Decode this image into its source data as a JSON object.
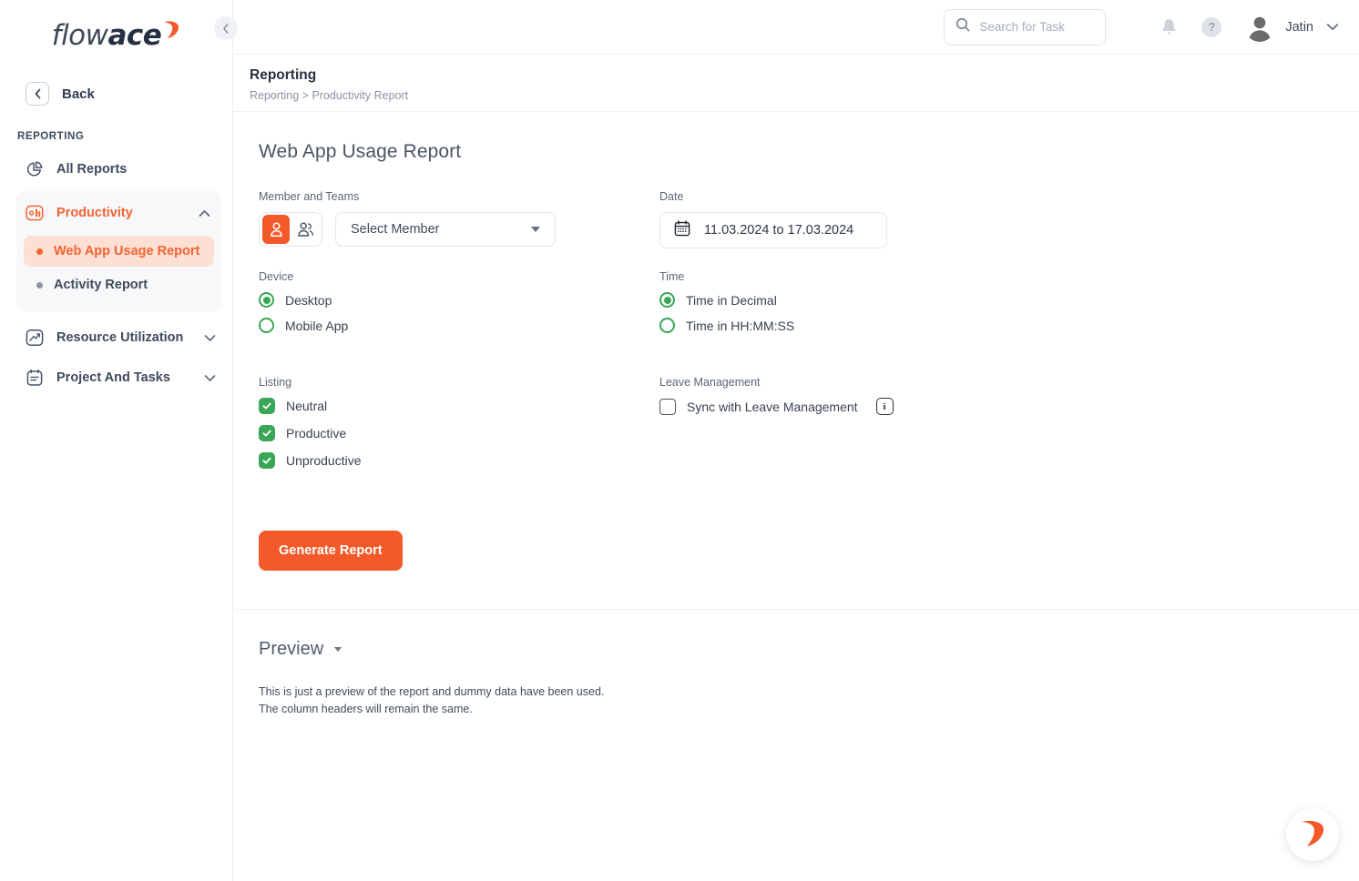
{
  "brand": {
    "logo_flow": "flow",
    "logo_ace": "ace",
    "accent_color": "#f4592a",
    "accent_light": "#fde0d3",
    "green": "#3aa757"
  },
  "sidebar": {
    "back_label": "Back",
    "section_label": "REPORTING",
    "items": [
      {
        "label": "All Reports",
        "icon": "pie-chart-icon"
      },
      {
        "label": "Productivity",
        "icon": "bar-chart-icon"
      },
      {
        "label": "Resource Utilization",
        "icon": "trend-up-icon"
      },
      {
        "label": "Project And Tasks",
        "icon": "calendar-list-icon"
      }
    ],
    "sub_items": [
      {
        "label": "Web App Usage Report"
      },
      {
        "label": "Activity Report"
      }
    ]
  },
  "topbar": {
    "search_placeholder": "Search for Task",
    "search_value": "",
    "help_label": "?",
    "user_name": "Jatin"
  },
  "page": {
    "title": "Reporting",
    "breadcrumb": "Reporting > Productivity Report",
    "report_title": "Web App Usage Report"
  },
  "form": {
    "member_label": "Member and Teams",
    "member_select_value": "Select Member",
    "date_label": "Date",
    "date_value": "11.03.2024 to 17.03.2024",
    "device_label": "Device",
    "device_options": [
      {
        "label": "Desktop",
        "selected": true
      },
      {
        "label": "Mobile App",
        "selected": false
      }
    ],
    "time_label": "Time",
    "time_options": [
      {
        "label": "Time in Decimal",
        "selected": true
      },
      {
        "label": "Time in HH:MM:SS",
        "selected": false
      }
    ],
    "listing_label": "Listing",
    "listing_options": [
      {
        "label": "Neutral",
        "checked": true
      },
      {
        "label": "Productive",
        "checked": true
      },
      {
        "label": "Unproductive",
        "checked": true
      }
    ],
    "leave_label": "Leave Management",
    "leave_sync_label": "Sync with Leave Management",
    "leave_sync_checked": false,
    "info_glyph": "i",
    "generate_button": "Generate Report"
  },
  "preview": {
    "title": "Preview",
    "note_line1": "This is just a preview of the report and dummy data have been used.",
    "note_line2": "The column headers will remain the same."
  }
}
